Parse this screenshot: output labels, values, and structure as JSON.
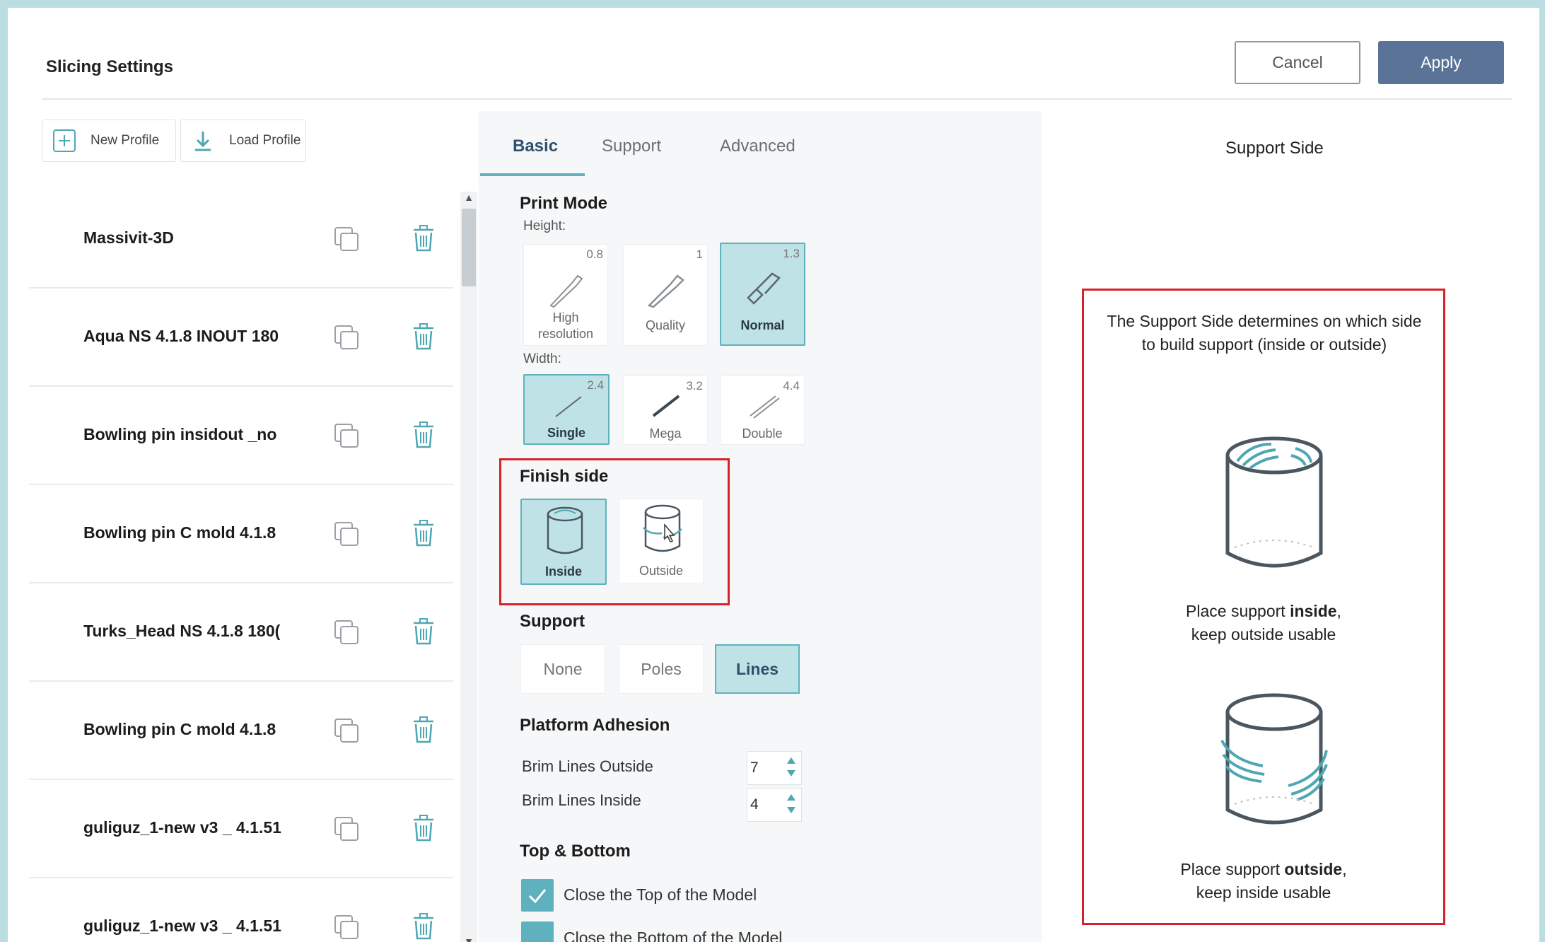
{
  "window": {
    "title": "Slicing Settings",
    "cancel_label": "Cancel",
    "apply_label": "Apply"
  },
  "toolbar": {
    "new_profile": "New Profile",
    "load_profile": "Load Profile"
  },
  "profiles": [
    {
      "name": "Massivit-3D"
    },
    {
      "name": "Aqua NS 4.1.8 INOUT 180"
    },
    {
      "name": "Bowling pin insidout _no"
    },
    {
      "name": "Bowling pin C mold 4.1.8"
    },
    {
      "name": "Turks_Head NS 4.1.8 180("
    },
    {
      "name": "Bowling pin C mold 4.1.8"
    },
    {
      "name": "guliguz_1-new v3 _ 4.1.51"
    },
    {
      "name": "guliguz_1-new v3 _ 4.1.51"
    }
  ],
  "tabs": {
    "basic": "Basic",
    "support": "Support",
    "advanced": "Advanced"
  },
  "print_mode": {
    "title": "Print Mode",
    "height_label": "Height:",
    "width_label": "Width:",
    "height_options": [
      {
        "value": "0.8",
        "label_line1": "High",
        "label_line2": "resolution",
        "icon": "knife-thin-icon"
      },
      {
        "value": "1",
        "label_line1": "Quality",
        "label_line2": "",
        "icon": "knife-medium-icon"
      },
      {
        "value": "1.3",
        "label_line1": "Normal",
        "label_line2": "",
        "icon": "knife-thick-icon",
        "selected": true
      }
    ],
    "width_options": [
      {
        "value": "2.4",
        "label": "Single",
        "icon": "single-line-icon",
        "selected": true
      },
      {
        "value": "3.2",
        "label": "Mega",
        "icon": "mega-line-icon"
      },
      {
        "value": "4.4",
        "label": "Double",
        "icon": "double-line-icon"
      }
    ]
  },
  "finish_side": {
    "title": "Finish side",
    "options": [
      {
        "label": "Inside",
        "icon": "cylinder-inside-icon",
        "selected": true
      },
      {
        "label": "Outside",
        "icon": "cylinder-outside-icon"
      }
    ]
  },
  "support": {
    "title": "Support",
    "options": [
      {
        "label": "None"
      },
      {
        "label": "Poles"
      },
      {
        "label": "Lines",
        "selected": true
      }
    ]
  },
  "platform_adhesion": {
    "title": "Platform Adhesion",
    "brim_outside_label": "Brim Lines Outside",
    "brim_outside_value": "7",
    "brim_inside_label": "Brim Lines Inside",
    "brim_inside_value": "4"
  },
  "top_bottom": {
    "title": "Top & Bottom",
    "close_top_label": "Close the Top of the Model",
    "close_top_checked": true,
    "close_bottom_label": "Close the Bottom of the Model",
    "close_bottom_checked": false
  },
  "help_panel": {
    "title": "Support Side",
    "description": "The Support Side determines on which side to build support (inside or outside)",
    "inside_prefix": "Place support ",
    "inside_bold": "inside",
    "inside_suffix": ",",
    "inside_line2": "keep outside usable",
    "outside_prefix": "Place support ",
    "outside_bold": "outside",
    "outside_suffix": ",",
    "outside_line2": "keep inside usable"
  },
  "colors": {
    "accent": "#5fb2bd",
    "selected_bg": "#bfe2e6",
    "apply_bg": "#5b7396",
    "highlight_border": "#d6222a"
  }
}
